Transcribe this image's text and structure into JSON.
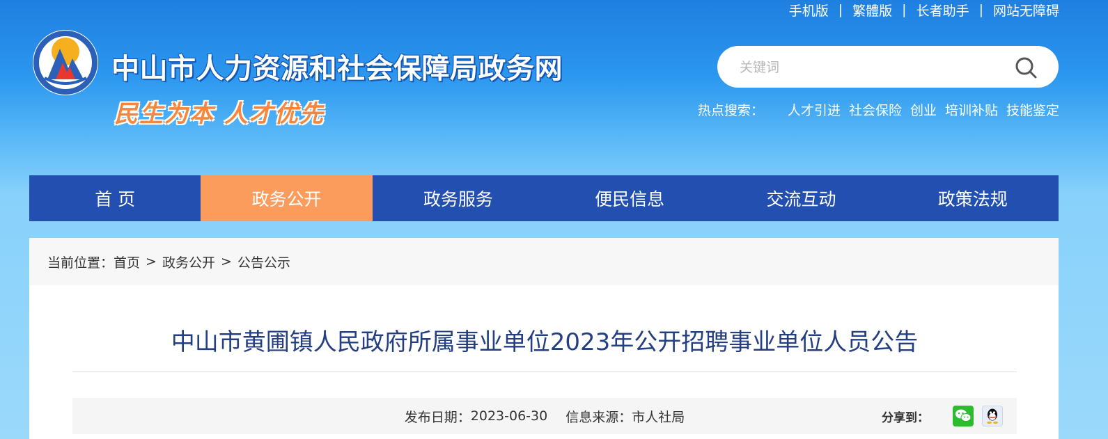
{
  "top_links": [
    "手机版",
    "繁體版",
    "长者助手",
    "网站无障碍"
  ],
  "top_links_separator": "|",
  "header": {
    "site_title": "中山市人力资源和社会保障局政务网",
    "slogan": "民生为本 人才优先"
  },
  "search": {
    "placeholder": "关键词",
    "hot_label": "热点搜索：",
    "hot_terms": [
      "人才引进",
      "社会保险",
      "创业",
      "培训补贴",
      "技能鉴定"
    ]
  },
  "nav": {
    "items": [
      "首 页",
      "政务公开",
      "政务服务",
      "便民信息",
      "交流互动",
      "政策法规"
    ],
    "active_index": 1
  },
  "breadcrumb": {
    "prefix": "当前位置：",
    "items": [
      "首页",
      "政务公开",
      "公告公示"
    ],
    "separator": ">"
  },
  "article": {
    "title": "中山市黄圃镇人民政府所属事业单位2023年公开招聘事业单位人员公告",
    "publish_label": "发布日期：",
    "publish_date": "2023-06-30",
    "source_label": "信息来源：",
    "source": "市人社局",
    "share_label": "分享到：",
    "share_icons": [
      "wechat-icon",
      "qq-icon"
    ]
  },
  "colors": {
    "nav_bg": "#2350b0",
    "nav_active": "#fb9c5d",
    "title": "#233f82",
    "slogan": "#f7853b"
  }
}
